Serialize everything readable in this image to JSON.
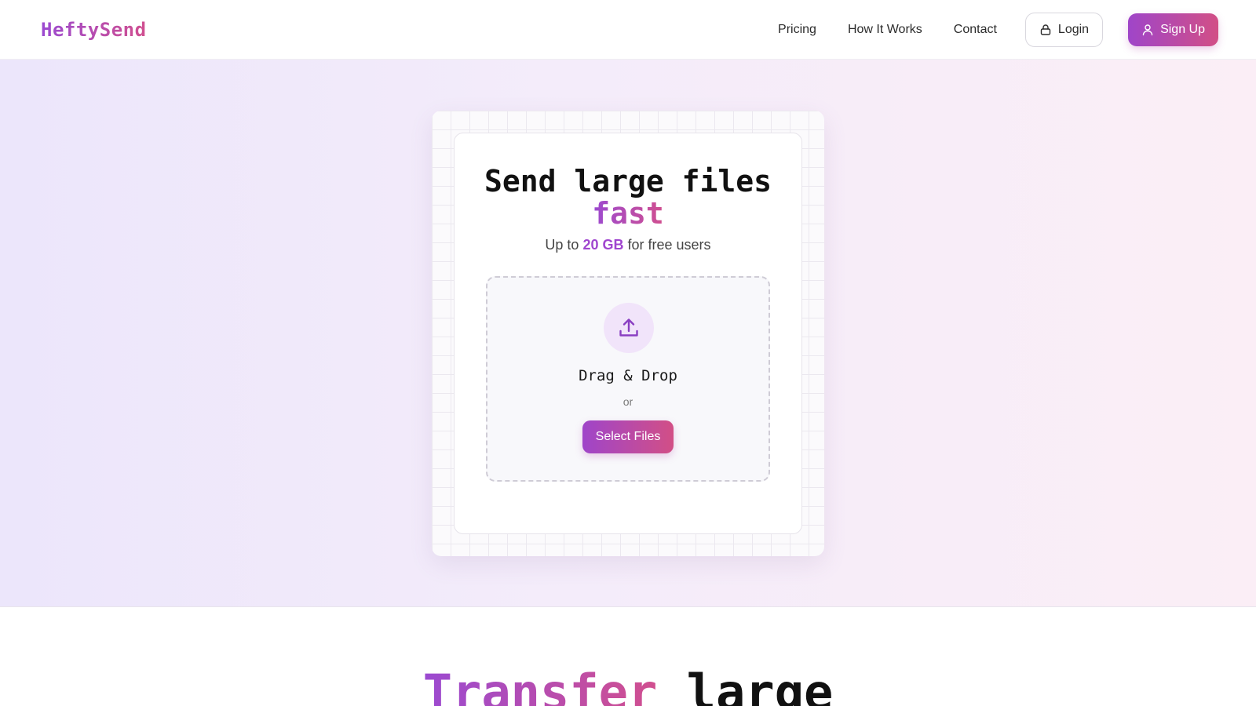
{
  "header": {
    "logo": "HeftySend",
    "nav": {
      "pricing": "Pricing",
      "how_it_works": "How It Works",
      "contact": "Contact"
    },
    "login_label": "Login",
    "signup_label": "Sign Up"
  },
  "hero": {
    "title_line1": "Send large files",
    "title_accent": "fast",
    "subtitle_prefix": "Up to",
    "subtitle_highlight": "20 GB",
    "subtitle_suffix": "for free users",
    "dropzone": {
      "icon": "upload-icon",
      "drag_text": "Drag & Drop",
      "or_text": "or",
      "select_label": "Select Files"
    }
  },
  "section2": {
    "title_accent": "Transfer",
    "title_rest": "large"
  },
  "colors": {
    "brand_start": "#9b4ad1",
    "brand_end": "#d14f8f"
  }
}
